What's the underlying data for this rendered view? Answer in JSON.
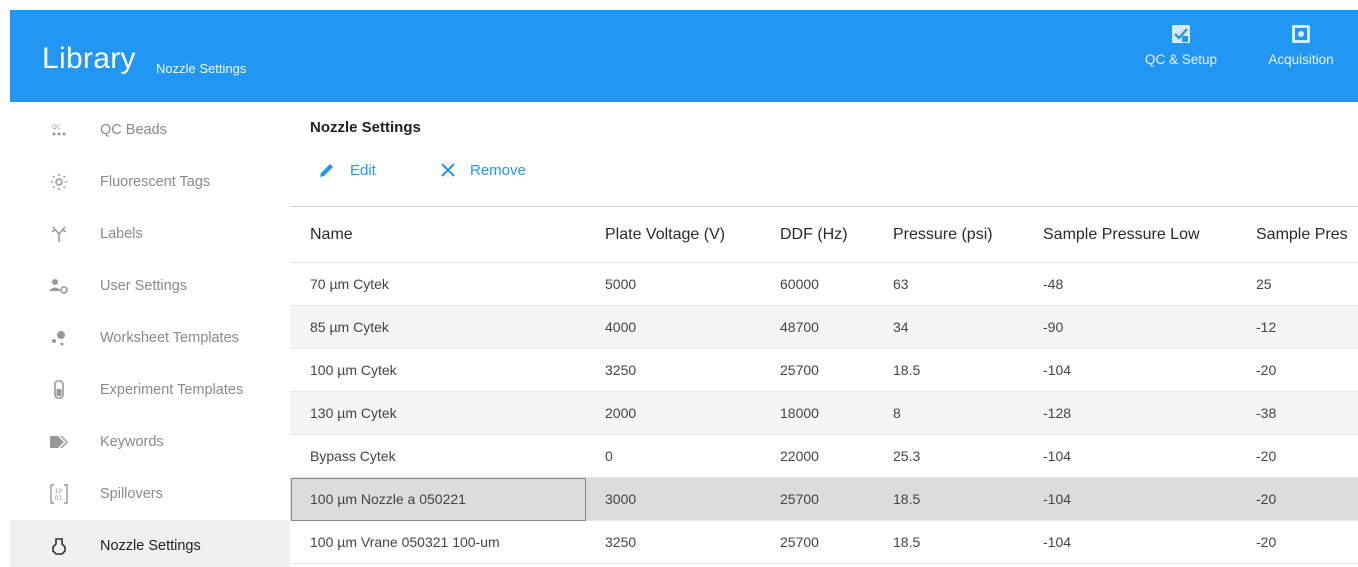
{
  "header": {
    "title": "Library",
    "subtitle": "Nozzle Settings",
    "nav": [
      {
        "label": "QC & Setup",
        "icon": "qc-setup-icon"
      },
      {
        "label": "Acquisition",
        "icon": "acquisition-icon"
      }
    ],
    "color": "#2196f3"
  },
  "sidebar": {
    "items": [
      {
        "label": "QC Beads",
        "icon": "qc-beads-icon"
      },
      {
        "label": "Fluorescent Tags",
        "icon": "fluorescent-tags-icon"
      },
      {
        "label": "Labels",
        "icon": "labels-icon"
      },
      {
        "label": "User Settings",
        "icon": "user-settings-icon"
      },
      {
        "label": "Worksheet Templates",
        "icon": "worksheet-templates-icon"
      },
      {
        "label": "Experiment Templates",
        "icon": "experiment-templates-icon"
      },
      {
        "label": "Keywords",
        "icon": "keywords-icon"
      },
      {
        "label": "Spillovers",
        "icon": "spillovers-icon"
      },
      {
        "label": "Nozzle Settings",
        "icon": "nozzle-settings-icon",
        "active": true
      }
    ]
  },
  "main": {
    "title": "Nozzle Settings",
    "toolbar": {
      "edit_label": "Edit",
      "remove_label": "Remove"
    },
    "columns": [
      "Name",
      "Plate Voltage (V)",
      "DDF (Hz)",
      "Pressure (psi)",
      "Sample Pressure Low",
      "Sample Pres"
    ],
    "rows": [
      [
        "70 µm Cytek",
        "5000",
        "60000",
        "63",
        "-48",
        "25"
      ],
      [
        "85 µm Cytek",
        "4000",
        "48700",
        "34",
        "-90",
        "-12"
      ],
      [
        "100 µm Cytek",
        "3250",
        "25700",
        "18.5",
        "-104",
        "-20"
      ],
      [
        "130 µm Cytek",
        "2000",
        "18000",
        "8",
        "-128",
        "-38"
      ],
      [
        "Bypass Cytek",
        "0",
        "22000",
        "25.3",
        "-104",
        "-20"
      ],
      [
        "100 µm Nozzle a 050221",
        "3000",
        "25700",
        "18.5",
        "-104",
        "-20"
      ],
      [
        "100 µm Vrane 050321 100-um",
        "3250",
        "25700",
        "18.5",
        "-104",
        "-20"
      ]
    ],
    "selected_row": 5
  }
}
